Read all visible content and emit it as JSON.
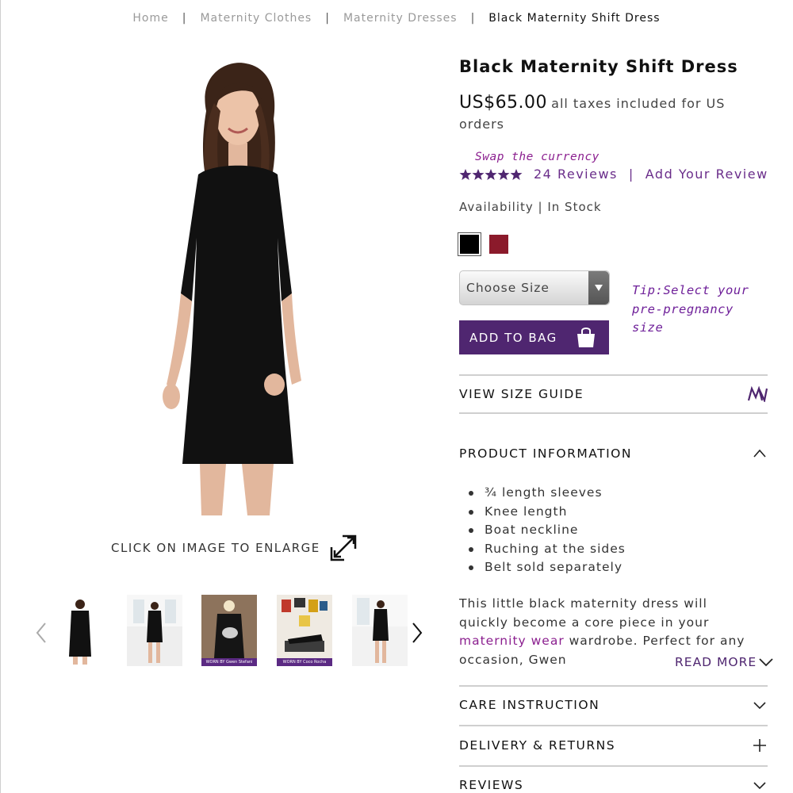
{
  "breadcrumb": {
    "items": [
      "Home",
      "Maternity Clothes",
      "Maternity Dresses",
      "Black Maternity Shift Dress"
    ],
    "separator": "|"
  },
  "gallery": {
    "enlarge_label": "CLICK ON IMAGE TO ENLARGE",
    "thumb_badges": [
      "WORN BY Gwen Stefani",
      "WORN BY Coco Rocha"
    ]
  },
  "product": {
    "title": "Black Maternity Shift Dress",
    "price": "US$65.00",
    "tax_note": "all taxes included for US orders",
    "swap_currency": "Swap the currency",
    "rating": 5,
    "reviews_count_label": "24 Reviews",
    "review_separator": "|",
    "add_review_label": "Add Your Review",
    "availability": "Availability | In Stock",
    "colors": [
      {
        "name": "Black",
        "hex": "#000000"
      },
      {
        "name": "Burgundy",
        "hex": "#8b1a2b"
      }
    ],
    "size_placeholder": "Choose Size",
    "size_tip": "Tip:Select your pre-pregnancy size",
    "add_to_bag": "ADD TO BAG",
    "accent_color": "#4f2670"
  },
  "sections": {
    "size_guide": "VIEW SIZE GUIDE",
    "product_information": "PRODUCT INFORMATION",
    "care": "CARE INSTRUCTION",
    "delivery": "DELIVERY & RETURNS",
    "reviews": "REVIEWS"
  },
  "info": {
    "bullets": [
      "¾ length sleeves",
      "Knee length",
      "Boat neckline",
      "Ruching at the sides",
      "Belt sold separately"
    ],
    "description_before": "This little black maternity dress will quickly become a core piece in your ",
    "description_link": "maternity wear",
    "description_after": " wardrobe. Perfect for any occasion, Gwen",
    "read_more": "READ MORE"
  }
}
